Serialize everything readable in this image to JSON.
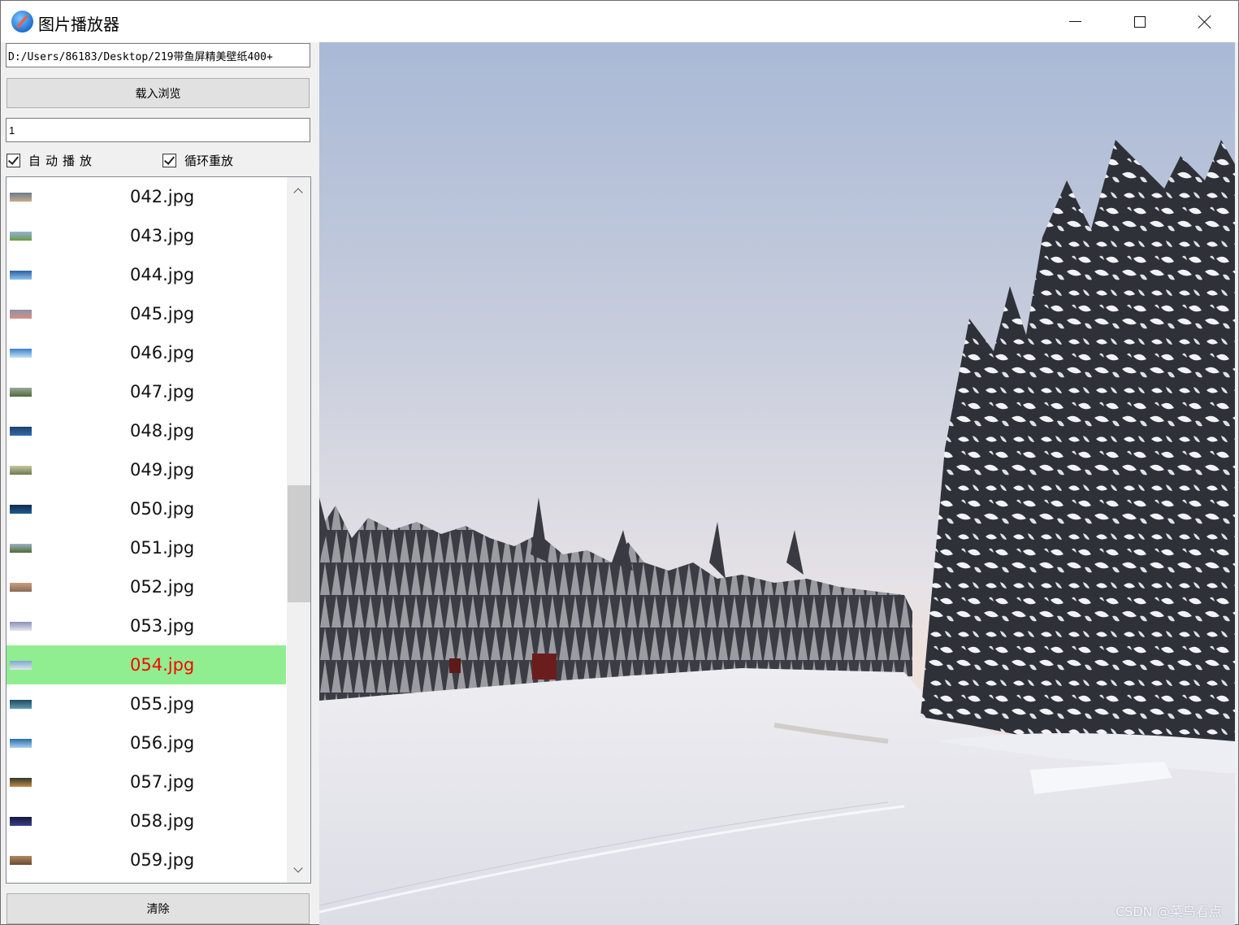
{
  "window": {
    "title": "图片播放器",
    "icon": "safari-compass-icon"
  },
  "controls": {
    "path_value": "D:/Users/86183/Desktop/219带鱼屏精美壁纸400+",
    "load_button": "载入浏览",
    "interval_value": "1",
    "auto_play_label": "自动播放",
    "auto_play_checked": true,
    "loop_label": "循环重放",
    "loop_checked": true,
    "clear_button": "清除"
  },
  "file_list": {
    "selected": "054.jpg",
    "selected_color": "#90ee90",
    "selected_text_color": "#ff0000",
    "items": [
      {
        "name": "042.jpg",
        "thumb": [
          "#6a7c8f",
          "#c9a98a"
        ]
      },
      {
        "name": "043.jpg",
        "thumb": [
          "#8fb3d9",
          "#6f9a44"
        ]
      },
      {
        "name": "044.jpg",
        "thumb": [
          "#2d5f9e",
          "#8cc2ef"
        ]
      },
      {
        "name": "045.jpg",
        "thumb": [
          "#8a94a8",
          "#d88e84"
        ]
      },
      {
        "name": "046.jpg",
        "thumb": [
          "#3d7fc8",
          "#bfe0f7"
        ]
      },
      {
        "name": "047.jpg",
        "thumb": [
          "#9aa7a0",
          "#4d6b34"
        ]
      },
      {
        "name": "048.jpg",
        "thumb": [
          "#1d3f6e",
          "#2f6ca8"
        ]
      },
      {
        "name": "049.jpg",
        "thumb": [
          "#c8c6a0",
          "#6b7a4f"
        ]
      },
      {
        "name": "050.jpg",
        "thumb": [
          "#0f2a4a",
          "#1f5c8e"
        ]
      },
      {
        "name": "051.jpg",
        "thumb": [
          "#9cb2c9",
          "#4e6b30"
        ]
      },
      {
        "name": "052.jpg",
        "thumb": [
          "#c7a07f",
          "#8a6a55"
        ]
      },
      {
        "name": "053.jpg",
        "thumb": [
          "#8a8fb8",
          "#e3e6f0"
        ]
      },
      {
        "name": "054.jpg",
        "thumb": [
          "#7fa6cc",
          "#dfe6ee"
        ]
      },
      {
        "name": "055.jpg",
        "thumb": [
          "#1e4a5e",
          "#5f9ab0"
        ]
      },
      {
        "name": "056.jpg",
        "thumb": [
          "#2a6aa8",
          "#a9cff0"
        ]
      },
      {
        "name": "057.jpg",
        "thumb": [
          "#2b3a28",
          "#c38a4a"
        ]
      },
      {
        "name": "058.jpg",
        "thumb": [
          "#141a3c",
          "#3a3f8a"
        ]
      },
      {
        "name": "059.jpg",
        "thumb": [
          "#b08a60",
          "#6b4b30"
        ]
      }
    ]
  },
  "viewer": {
    "image": "054.jpg",
    "watermark": "CSDN @菜鸟看点"
  }
}
